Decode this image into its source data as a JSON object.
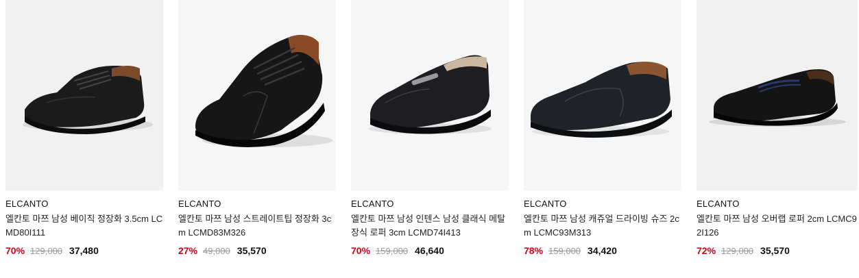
{
  "products": [
    {
      "brand": "ELCANTO",
      "name": "엘칸토 마쯔 남성 베이직 정장화 3.5cm LCMD80I111",
      "discount": "70%",
      "original_price": "129,000",
      "price": "37,480",
      "image": "derby-shoe-icon"
    },
    {
      "brand": "ELCANTO",
      "name": "엘칸토 마쯔 남성 스트레이트팁 정장화 3cm LCMD83M326",
      "discount": "27%",
      "original_price": "49,000",
      "price": "35,570",
      "image": "cap-toe-oxford-icon"
    },
    {
      "brand": "ELCANTO",
      "name": "엘칸토 마쯔 남성 인텐스 남성 클래식 메탈 장식 로퍼 3cm LCMD74I413",
      "discount": "70%",
      "original_price": "159,000",
      "price": "46,640",
      "image": "bit-loafer-icon"
    },
    {
      "brand": "ELCANTO",
      "name": "엘칸토 마쯔 남성 캐쥬얼 드라이빙 슈즈 2cm LCMC93M313",
      "discount": "78%",
      "original_price": "159,000",
      "price": "34,420",
      "image": "driving-shoe-icon"
    },
    {
      "brand": "ELCANTO",
      "name": "엘칸토 마쯔 남성 오버랩 로퍼 2cm LCMC92I126",
      "discount": "72%",
      "original_price": "129,000",
      "price": "35,570",
      "image": "penny-loafer-icon"
    }
  ]
}
